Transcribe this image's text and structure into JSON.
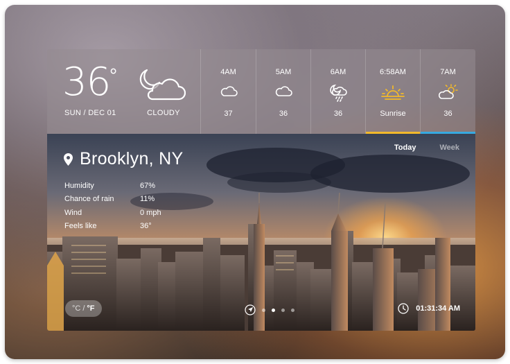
{
  "current": {
    "temperature": "36",
    "degree_symbol": "°",
    "date": "SUN / DEC 01",
    "condition": "CLOUDY",
    "icon": "partly-cloudy-night-icon"
  },
  "hourly": [
    {
      "time": "4AM",
      "icon": "cloud-icon",
      "value": "37"
    },
    {
      "time": "5AM",
      "icon": "cloud-icon",
      "value": "36"
    },
    {
      "time": "6AM",
      "icon": "night-drizzle-icon",
      "value": "36"
    },
    {
      "time": "6:58AM",
      "icon": "sunrise-icon",
      "value": "Sunrise"
    },
    {
      "time": "7AM",
      "icon": "partly-sunny-icon",
      "value": "36"
    }
  ],
  "location": {
    "name": "Brooklyn, NY",
    "icon": "location-pin-icon"
  },
  "stats": [
    {
      "label": "Humidity",
      "value": "67%"
    },
    {
      "label": "Chance of rain",
      "value": "11%"
    },
    {
      "label": "Wind",
      "value": "0 mph"
    },
    {
      "label": "Feels like",
      "value": "36°"
    }
  ],
  "tabs": {
    "today": "Today",
    "week": "Week"
  },
  "units": {
    "celsius": "°C",
    "separator": "/",
    "fahrenheit": "°F"
  },
  "pager": {
    "pages": 4,
    "active": 1
  },
  "clock": {
    "time": "01:31:34 AM",
    "icon": "clock-icon"
  },
  "colors": {
    "sunrise_accent": "#f2b92b",
    "active_tab_accent": "#37a9e0"
  }
}
